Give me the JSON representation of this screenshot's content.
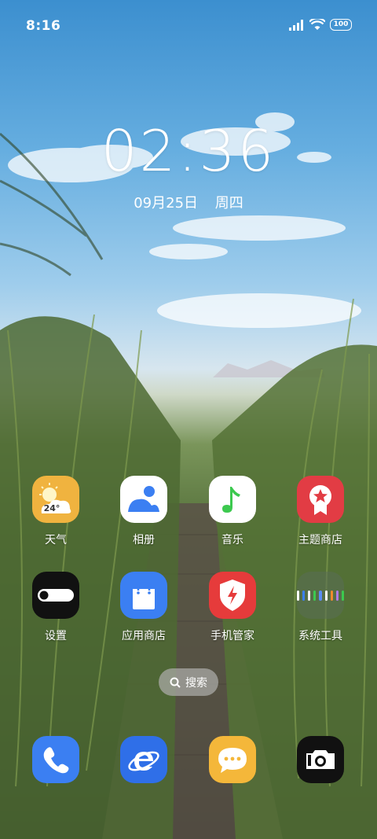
{
  "status_bar": {
    "time": "8:16",
    "battery": "100"
  },
  "lock": {
    "clock": "02:36",
    "date": "09月25日",
    "weekday": "周四"
  },
  "apps_row1": [
    {
      "label": "天气",
      "temp": "24°",
      "icon": "weather-icon"
    },
    {
      "label": "相册",
      "icon": "gallery-icon"
    },
    {
      "label": "音乐",
      "icon": "music-icon"
    },
    {
      "label": "主题商店",
      "icon": "theme-store-icon"
    }
  ],
  "apps_row2": [
    {
      "label": "设置",
      "icon": "settings-toggle-icon"
    },
    {
      "label": "应用商店",
      "icon": "app-store-bag-icon"
    },
    {
      "label": "手机管家",
      "icon": "phone-manager-shield-icon"
    },
    {
      "label": "系统工具",
      "icon": "folder-icon"
    }
  ],
  "search": {
    "label": "搜索"
  },
  "dock": [
    {
      "icon": "phone-icon"
    },
    {
      "icon": "browser-icon"
    },
    {
      "icon": "messages-icon"
    },
    {
      "icon": "camera-icon"
    }
  ],
  "colors": {
    "weather": "#f0b33f",
    "gallery_bg": "#ffffff",
    "gallery_fg": "#3b7ff2",
    "music_bg": "#ffffff",
    "music_fg": "#3cc94f",
    "theme_store": "#e23c44",
    "settings": "#111111",
    "app_store": "#3b7ff2",
    "phone_manager": "#e63b3b",
    "phone": "#3b7ff2",
    "browser": "#2f6fe8",
    "messages": "#f4b73a",
    "camera": "#111111"
  }
}
